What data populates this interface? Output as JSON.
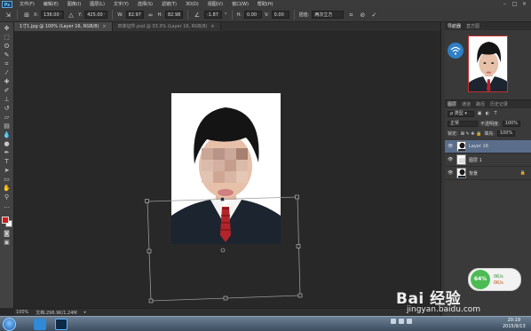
{
  "menubar": {
    "logo": "Ps",
    "items": [
      "文件(F)",
      "编辑(E)",
      "图像(I)",
      "图层(L)",
      "文字(Y)",
      "选择(S)",
      "滤镜(T)",
      "3D(D)",
      "视图(V)",
      "窗口(W)",
      "帮助(H)"
    ]
  },
  "options": {
    "x_label": "X:",
    "x_value": "136.00 像素",
    "y_label": "Y:",
    "y_value": "425.00 像素",
    "w_label": "W:",
    "w_value": "82.97%",
    "h_label": "H:",
    "h_value": "82.98%",
    "angle_value": "-1.87",
    "hskew_label": "H:",
    "hskew_value": "0.00",
    "vskew_label": "V:",
    "vskew_value": "0.00",
    "interp_label": "插值:",
    "interp_value": "两次立方"
  },
  "tabs": [
    {
      "label": "1寸1.jpg @ 100% (Layer 16, RGB/8)",
      "active": true
    },
    {
      "label": "四家证件.psd @ 33.3% (Layer 16, RGB/8)",
      "active": false
    }
  ],
  "status": {
    "zoom": "100%",
    "doc_info": "文档:296.9K/1.24M"
  },
  "panels": {
    "nav_tabs": [
      "导航器",
      "直方图"
    ],
    "layer_tabs": [
      "图层",
      "通道",
      "路径",
      "历史记录"
    ],
    "blend_mode": "正常",
    "opacity_label": "不透明度:",
    "opacity_value": "100%",
    "lock_label": "锁定:",
    "fill_label": "填充:",
    "fill_value": "100%",
    "layers": [
      {
        "name": "Layer 16",
        "selected": true,
        "locked": false
      },
      {
        "name": "图层 1",
        "selected": false,
        "locked": false
      },
      {
        "name": "背景",
        "selected": false,
        "locked": true
      }
    ]
  },
  "monitor": {
    "percent": "64%",
    "up_speed": "0K/s",
    "down_speed": "0K/s"
  },
  "watermark": {
    "logo": "Bai 经验",
    "url": "jingyan.baidu.com"
  },
  "taskbar": {
    "time": "20:19",
    "date": "2015/9/13"
  },
  "colors": {
    "foreground": "#d21a1a",
    "background": "#ffffff",
    "accent": "#5a6e8c"
  }
}
